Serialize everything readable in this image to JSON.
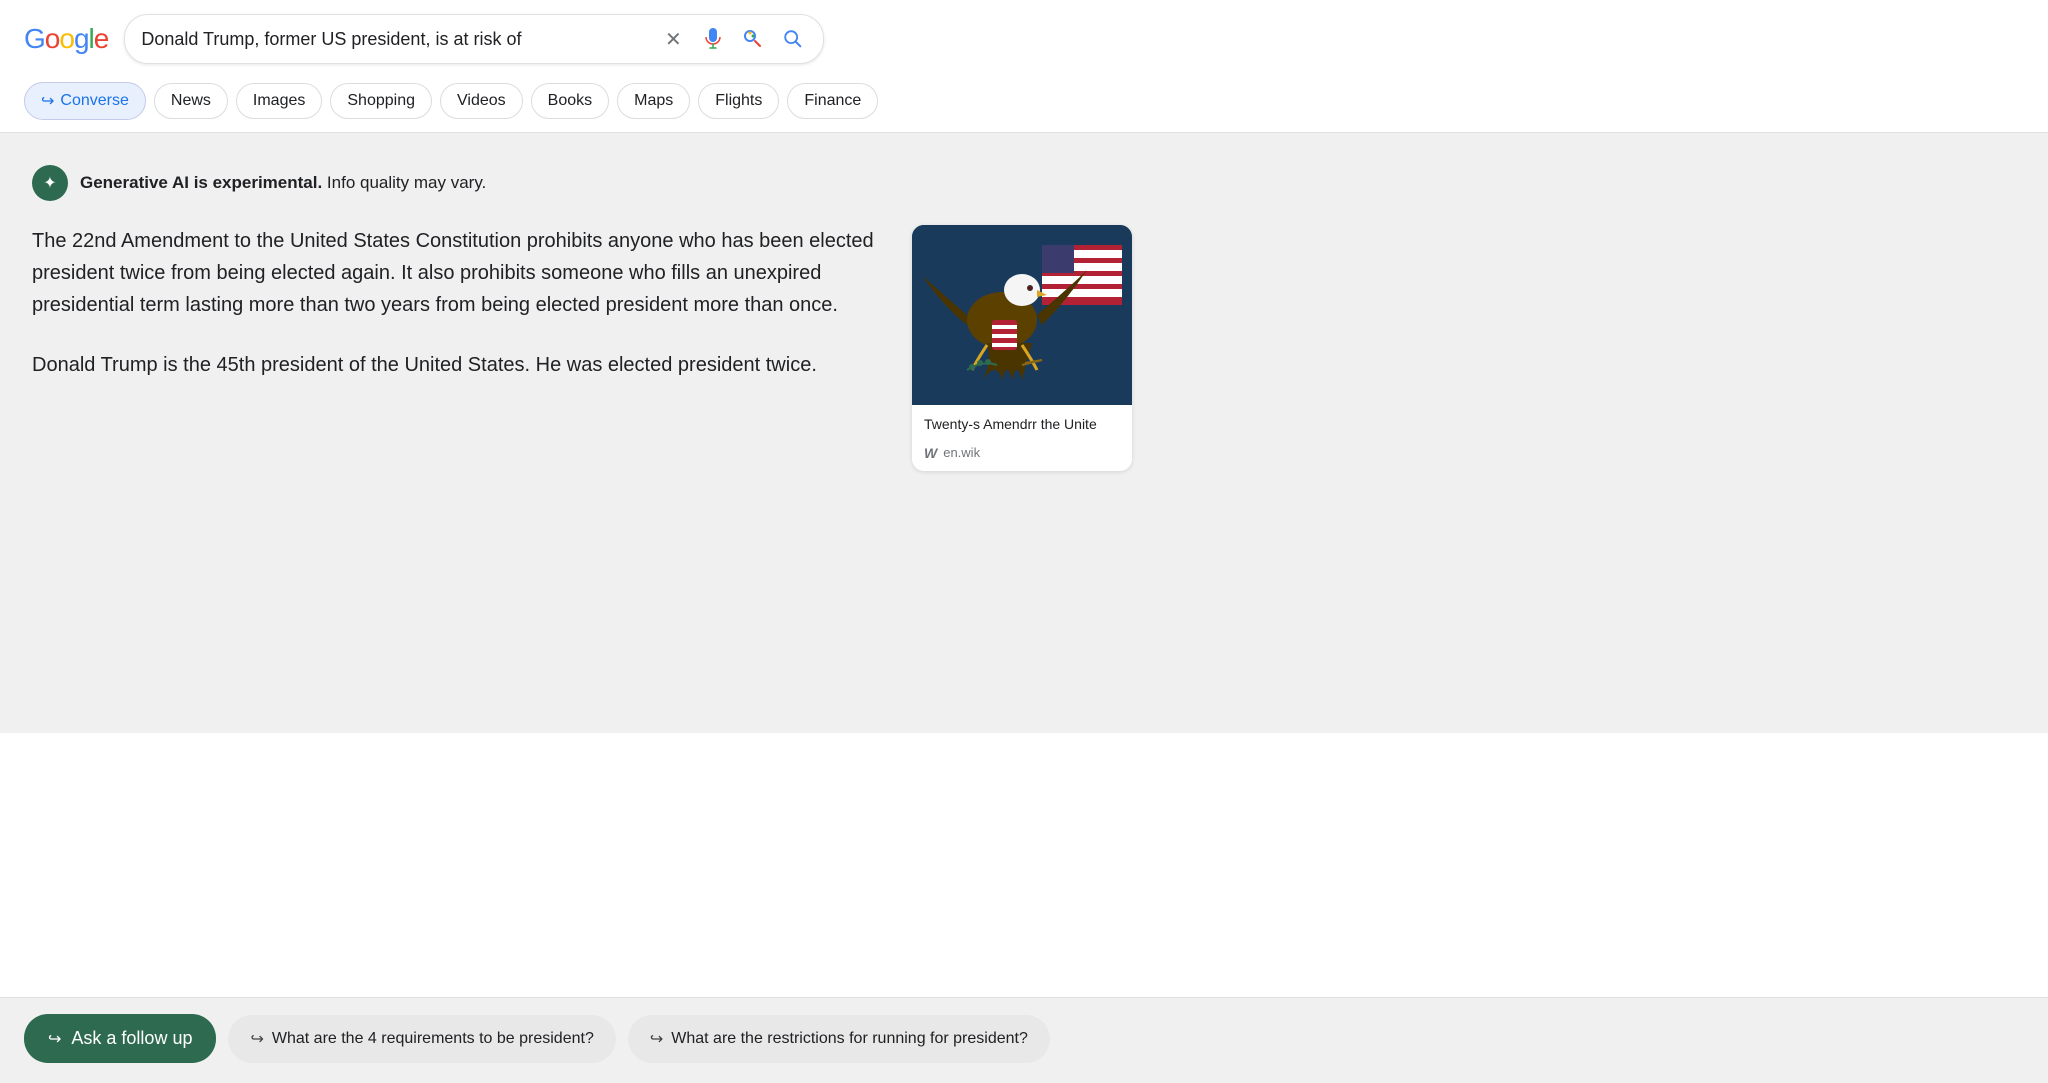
{
  "header": {
    "logo": {
      "letters": [
        "G",
        "o",
        "o",
        "g",
        "l",
        "e"
      ],
      "colors": [
        "#4285F4",
        "#EA4335",
        "#FBBC05",
        "#4285F4",
        "#34A853",
        "#EA4335"
      ]
    },
    "search_query": "Donald Trump, former US president, is at risk of",
    "clear_label": "×"
  },
  "filter_bar": {
    "chips": [
      {
        "id": "converse",
        "label": "Converse",
        "active": true,
        "has_arrow": true
      },
      {
        "id": "news",
        "label": "News",
        "active": false,
        "has_arrow": false
      },
      {
        "id": "images",
        "label": "Images",
        "active": false,
        "has_arrow": false
      },
      {
        "id": "shopping",
        "label": "Shopping",
        "active": false,
        "has_arrow": false
      },
      {
        "id": "videos",
        "label": "Videos",
        "active": false,
        "has_arrow": false
      },
      {
        "id": "books",
        "label": "Books",
        "active": false,
        "has_arrow": false
      },
      {
        "id": "maps",
        "label": "Maps",
        "active": false,
        "has_arrow": false
      },
      {
        "id": "flights",
        "label": "Flights",
        "active": false,
        "has_arrow": false
      },
      {
        "id": "finance",
        "label": "Finance",
        "active": false,
        "has_arrow": false
      }
    ]
  },
  "ai_response": {
    "disclaimer_bold": "Generative AI is experimental.",
    "disclaimer_normal": " Info quality may vary.",
    "paragraphs": [
      "The 22nd Amendment to the United States Constitution prohibits anyone who has been elected president twice from being elected again. It also prohibits someone who fills an unexpired presidential term lasting more than two years from being elected president more than once.",
      "Donald Trump is the 45th president of the United States. He was elected president twice."
    ]
  },
  "sidebar_card": {
    "title": "Twenty-s\nAmendrr\nthe Unite",
    "source_icon": "W",
    "source_url": "en.wik"
  },
  "bottom_bar": {
    "ask_followup_label": "Ask a follow up",
    "suggestions": [
      "What are the 4 requirements to be president?",
      "What are the restrictions for running for president?"
    ]
  }
}
